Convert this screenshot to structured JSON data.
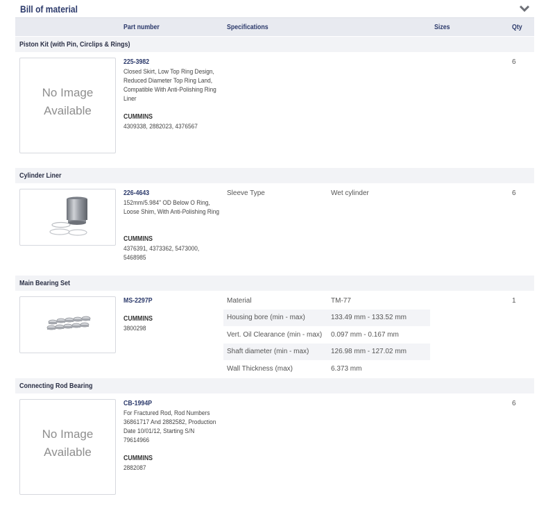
{
  "header": {
    "title": "Bill of material",
    "collapse_icon": "chevron-down-icon"
  },
  "columns": {
    "part_number": "Part number",
    "specifications": "Specifications",
    "sizes": "Sizes",
    "qty": "Qty"
  },
  "groups": [
    {
      "name": "Piston Kit (with Pin, Circlips & Rings)",
      "image": {
        "type": "none",
        "text_line1": "No Image",
        "text_line2": "Available"
      },
      "part_number": "225-3982",
      "description": "Closed Skirt, Low Top Ring Design, Reduced Diameter Top Ring Land, Compatible With Anti-Polishing Ring Liner",
      "brand": "CUMMINS",
      "oem_numbers": "4309338, 2882023, 4376567",
      "qty": "6",
      "specs": []
    },
    {
      "name": "Cylinder Liner",
      "image": {
        "type": "photo",
        "icon": "cylinder-liner-icon"
      },
      "part_number": "226-4643",
      "description": "152mm/5.984\" OD Below O Ring, Loose Shim, With Anti-Polishing Ring",
      "brand": "CUMMINS",
      "oem_numbers": "4376391, 4373362, 5473000, 5468985",
      "qty": "6",
      "specs": [
        {
          "label": "Sleeve Type",
          "value": "Wet cylinder"
        }
      ]
    },
    {
      "name": "Main Bearing Set",
      "image": {
        "type": "photo",
        "icon": "bearing-set-icon"
      },
      "part_number": "MS-2297P",
      "description": "",
      "brand": "CUMMINS",
      "oem_numbers": "3800298",
      "qty": "1",
      "specs": [
        {
          "label": "Material",
          "value": "TM-77"
        },
        {
          "label": "Housing bore (min - max)",
          "value": "133.49 mm - 133.52 mm"
        },
        {
          "label": "Vert. Oil Clearance (min - max)",
          "value": "0.097 mm - 0.167 mm"
        },
        {
          "label": "Shaft diameter (min - max)",
          "value": "126.98 mm - 127.02 mm"
        },
        {
          "label": "Wall Thickness (max)",
          "value": "6.373 mm"
        }
      ]
    },
    {
      "name": "Connecting Rod Bearing",
      "image": {
        "type": "none",
        "text_line1": "No Image",
        "text_line2": "Available"
      },
      "part_number": "CB-1994P",
      "description": "For Fractured Rod, Rod Numbers 36861717 And 2882582, Production Date 10/01/12, Starting S/N 79614966",
      "brand": "CUMMINS",
      "oem_numbers": "2882087",
      "qty": "6",
      "specs": []
    }
  ]
}
